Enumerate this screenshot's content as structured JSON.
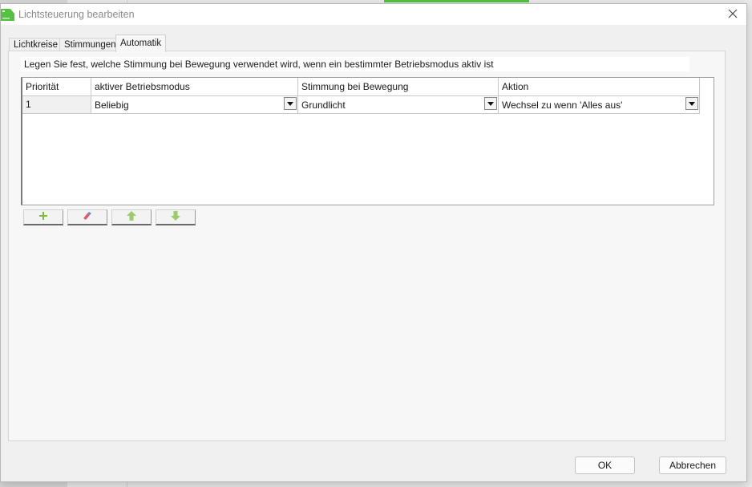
{
  "window": {
    "title": "Lichtsteuerung bearbeiten"
  },
  "tabs": [
    {
      "label": "Lichtkreise"
    },
    {
      "label": "Stimmungen"
    },
    {
      "label": "Automatik",
      "active": true
    }
  ],
  "automatik": {
    "description": "Legen Sie fest, welche Stimmung bei Bewegung verwendet wird, wenn ein bestimmter Betriebsmodus aktiv ist",
    "columns": [
      "Priorität",
      "aktiver Betriebsmodus",
      "Stimmung bei Bewegung",
      "Aktion"
    ],
    "rows": [
      {
        "prio": "1",
        "mode": "Beliebig",
        "scene": "Grundlicht",
        "action": "Wechsel zu wenn 'Alles aus'"
      }
    ],
    "tool_buttons": [
      {
        "icon": "plus-icon"
      },
      {
        "icon": "eraser-icon"
      },
      {
        "icon": "arrow-up-icon"
      },
      {
        "icon": "arrow-down-icon"
      }
    ]
  },
  "footer": {
    "ok_label": "OK",
    "cancel_label": "Abbrechen"
  },
  "colors": {
    "accent_green": "#4cc43d",
    "icon_green": "#7dbb3a",
    "eraser_red": "#e05a6a",
    "eraser_blue": "#5a8fd6"
  }
}
